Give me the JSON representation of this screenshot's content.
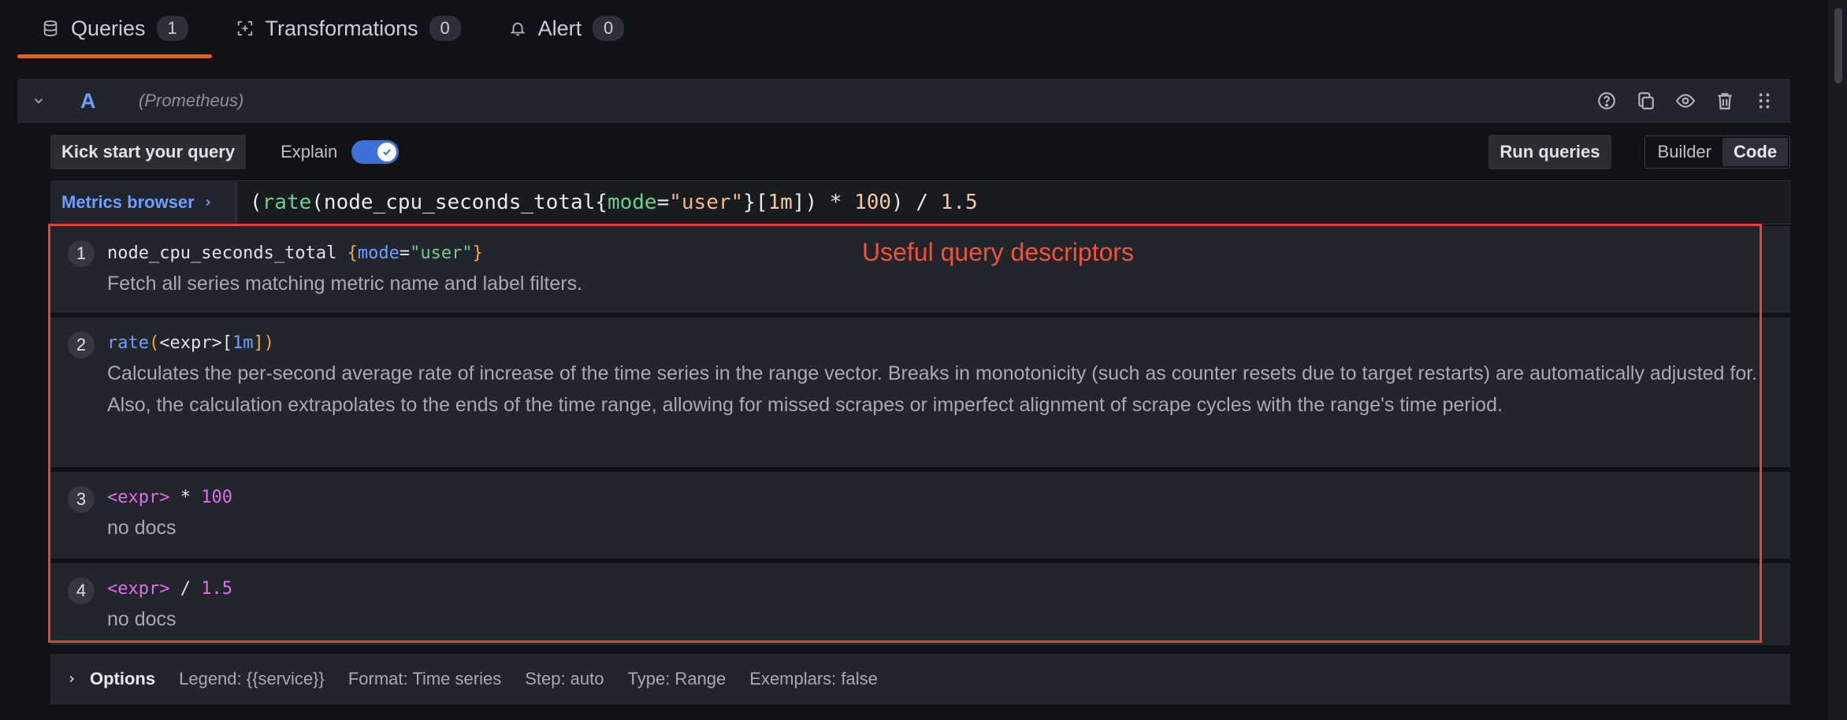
{
  "tabs": [
    {
      "label": "Queries",
      "count": "1",
      "icon": "database-icon"
    },
    {
      "label": "Transformations",
      "count": "0",
      "icon": "transform-icon"
    },
    {
      "label": "Alert",
      "count": "0",
      "icon": "bell-icon"
    }
  ],
  "query": {
    "ref": "A",
    "datasource": "(Prometheus)"
  },
  "toolbar": {
    "kickstart_label": "Kick start your query",
    "explain_label": "Explain",
    "explain_on": true,
    "run_label": "Run queries",
    "builder_label": "Builder",
    "code_label": "Code",
    "mode": "Code"
  },
  "editor": {
    "metrics_browser_label": "Metrics browser",
    "tokens": {
      "p1": "(",
      "fn": "rate",
      "p2": "(node_cpu_seconds_total{",
      "label": "mode",
      "eq": "=",
      "str": "\"user\"",
      "p3": "}[",
      "dur": "1m",
      "p4": "]) * ",
      "num1": "100",
      "p5": ") / ",
      "num2": "1.5"
    }
  },
  "annotation": "Useful query descriptors",
  "steps": [
    {
      "num": "1",
      "expr": {
        "metric": "node_cpu_seconds_total ",
        "ob": "{",
        "label": "mode",
        "eq": "=",
        "str": "\"user\"",
        "cb": "}"
      },
      "desc": "Fetch all series matching metric name and label filters."
    },
    {
      "num": "2",
      "expr": {
        "fn": "rate",
        "op": "(",
        "inner": "<expr>[",
        "dur": "1m",
        "close": "])"
      },
      "desc": "Calculates the per-second average rate of increase of the time series in the range vector. Breaks in monotonicity (such as counter resets due to target restarts) are automatically adjusted for. Also, the calculation extrapolates to the ends of the time range, allowing for missed scrapes or imperfect alignment of scrape cycles with the range's time period."
    },
    {
      "num": "3",
      "expr": {
        "expr": "<expr>",
        "op": " * ",
        "num": "100"
      },
      "desc": "no docs"
    },
    {
      "num": "4",
      "expr": {
        "expr": "<expr>",
        "op": " / ",
        "num": "1.5"
      },
      "desc": "no docs"
    }
  ],
  "options": {
    "title": "Options",
    "legend": "Legend: {{service}}",
    "format": "Format: Time series",
    "step": "Step: auto",
    "type": "Type: Range",
    "exemplars": "Exemplars: false"
  },
  "colors": {
    "accent": "#f05a28",
    "annotation": "#e8442c",
    "link": "#6e9fff",
    "toggle": "#3d71d9"
  }
}
